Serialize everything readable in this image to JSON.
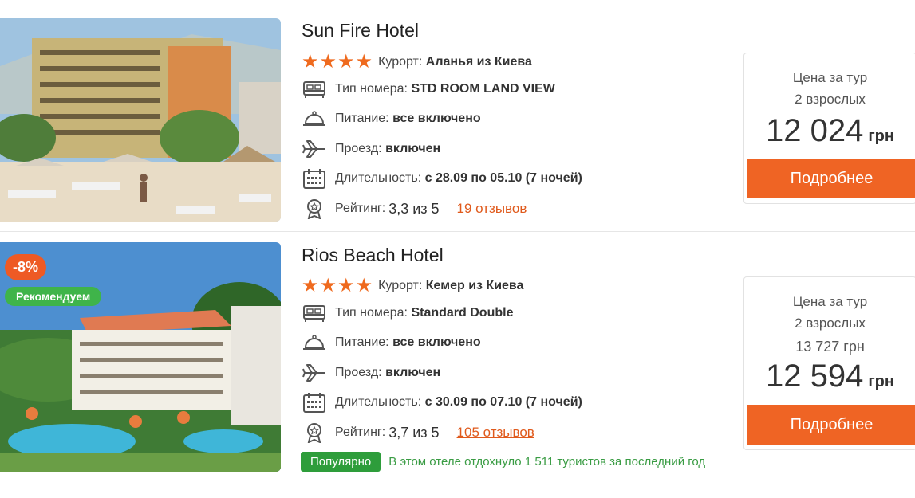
{
  "hotels": [
    {
      "name": "Sun Fire Hotel",
      "resort_label": "Курорт:",
      "resort_value": "Аланья из Киева",
      "room_label": "Тип номера:",
      "room_value": "STD ROOM LAND VIEW",
      "meal_label": "Питание:",
      "meal_value": "все включено",
      "transfer_label": "Проезд:",
      "transfer_value": "включен",
      "duration_label": "Длительность:",
      "duration_value": "с 28.09 по 05.10 (7 ночей)",
      "rating_label": "Рейтинг:",
      "rating_value": "3,3 из 5",
      "reviews": "19 отзывов",
      "stars": 4,
      "price_label_1": "Цена за тур",
      "price_label_2": "2 взрослых",
      "price": "12 024",
      "currency": "грн",
      "button": "Подробнее"
    },
    {
      "name": "Rios Beach Hotel",
      "discount_badge": "-8%",
      "recommend_badge": "Рекомендуем",
      "resort_label": "Курорт:",
      "resort_value": "Кемер из Киева",
      "room_label": "Тип номера:",
      "room_value": "Standard Double",
      "meal_label": "Питание:",
      "meal_value": "все включено",
      "transfer_label": "Проезд:",
      "transfer_value": "включен",
      "duration_label": "Длительность:",
      "duration_value": "с 30.09 по 07.10 (7 ночей)",
      "rating_label": "Рейтинг:",
      "rating_value": "3,7 из 5",
      "reviews": "105 отзывов",
      "stars": 4,
      "price_label_1": "Цена за тур",
      "price_label_2": "2 взрослых",
      "old_price": "13 727 грн",
      "price": "12 594",
      "currency": "грн",
      "button": "Подробнее",
      "popular_badge": "Популярно",
      "popular_text": "В этом отеле отдохнуло 1 511 туристов за последний год"
    }
  ],
  "icons": [
    "star-icon",
    "bed-icon",
    "cloche-icon",
    "plane-icon",
    "calendar-icon",
    "award-icon"
  ],
  "colors": {
    "accent": "#ef6424",
    "star": "#ef6a1e",
    "popular": "#2e9d3b",
    "recommend": "#3fb44a"
  }
}
